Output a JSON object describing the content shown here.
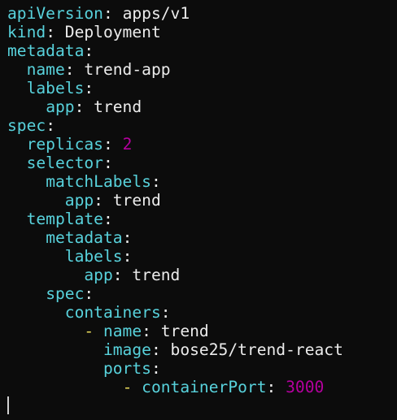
{
  "editor": {
    "lines": [
      {
        "indent": "",
        "dash": "",
        "key": "apiVersion",
        "value": "apps/v1",
        "value_type": "string"
      },
      {
        "indent": "",
        "dash": "",
        "key": "kind",
        "value": "Deployment",
        "value_type": "string"
      },
      {
        "indent": "",
        "dash": "",
        "key": "metadata",
        "value": "",
        "value_type": "none"
      },
      {
        "indent": "  ",
        "dash": "",
        "key": "name",
        "value": "trend-app",
        "value_type": "string"
      },
      {
        "indent": "  ",
        "dash": "",
        "key": "labels",
        "value": "",
        "value_type": "none"
      },
      {
        "indent": "    ",
        "dash": "",
        "key": "app",
        "value": "trend",
        "value_type": "string"
      },
      {
        "indent": "",
        "dash": "",
        "key": "spec",
        "value": "",
        "value_type": "none"
      },
      {
        "indent": "  ",
        "dash": "",
        "key": "replicas",
        "value": "2",
        "value_type": "number"
      },
      {
        "indent": "  ",
        "dash": "",
        "key": "selector",
        "value": "",
        "value_type": "none"
      },
      {
        "indent": "    ",
        "dash": "",
        "key": "matchLabels",
        "value": "",
        "value_type": "none"
      },
      {
        "indent": "      ",
        "dash": "",
        "key": "app",
        "value": "trend",
        "value_type": "string"
      },
      {
        "indent": "  ",
        "dash": "",
        "key": "template",
        "value": "",
        "value_type": "none"
      },
      {
        "indent": "    ",
        "dash": "",
        "key": "metadata",
        "value": "",
        "value_type": "none"
      },
      {
        "indent": "      ",
        "dash": "",
        "key": "labels",
        "value": "",
        "value_type": "none"
      },
      {
        "indent": "        ",
        "dash": "",
        "key": "app",
        "value": "trend",
        "value_type": "string"
      },
      {
        "indent": "    ",
        "dash": "",
        "key": "spec",
        "value": "",
        "value_type": "none"
      },
      {
        "indent": "      ",
        "dash": "",
        "key": "containers",
        "value": "",
        "value_type": "none"
      },
      {
        "indent": "        ",
        "dash": "-",
        "key": "name",
        "value": "trend",
        "value_type": "string"
      },
      {
        "indent": "          ",
        "dash": "",
        "key": "image",
        "value": "bose25/trend-react",
        "value_type": "string"
      },
      {
        "indent": "          ",
        "dash": "",
        "key": "ports",
        "value": "",
        "value_type": "none"
      },
      {
        "indent": "            ",
        "dash": "-",
        "key": "containerPort",
        "value": "3000",
        "value_type": "number"
      }
    ]
  },
  "colors": {
    "background": "#0c0c0c",
    "key": "#58d2dc",
    "text": "#ececec",
    "number": "#b4009e",
    "list_dash": "#e6d85a",
    "cursor": "#d0d0d0"
  }
}
